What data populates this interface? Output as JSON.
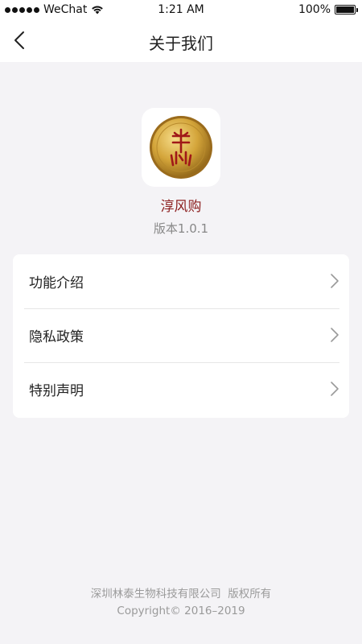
{
  "status_bar": {
    "carrier": "WeChat",
    "time": "1:21 AM",
    "battery": "100%",
    "battery_level": 1.0,
    "signal_dots": 5
  },
  "nav": {
    "title": "关于我们",
    "back_icon": "chevron-left-icon"
  },
  "app": {
    "icon": "app-logo-icon",
    "name": "淳风购",
    "version": "版本1.0.1",
    "accent_color": "#8c1f1f"
  },
  "menu": {
    "items": [
      {
        "label": "功能介绍",
        "icon": "chevron-right-icon"
      },
      {
        "label": "隐私政策",
        "icon": "chevron-right-icon"
      },
      {
        "label": "特别声明",
        "icon": "chevron-right-icon"
      }
    ]
  },
  "footer": {
    "company": "深圳林泰生物科技有限公司  版权所有",
    "copyright": "Copyright© 2016–2019"
  }
}
